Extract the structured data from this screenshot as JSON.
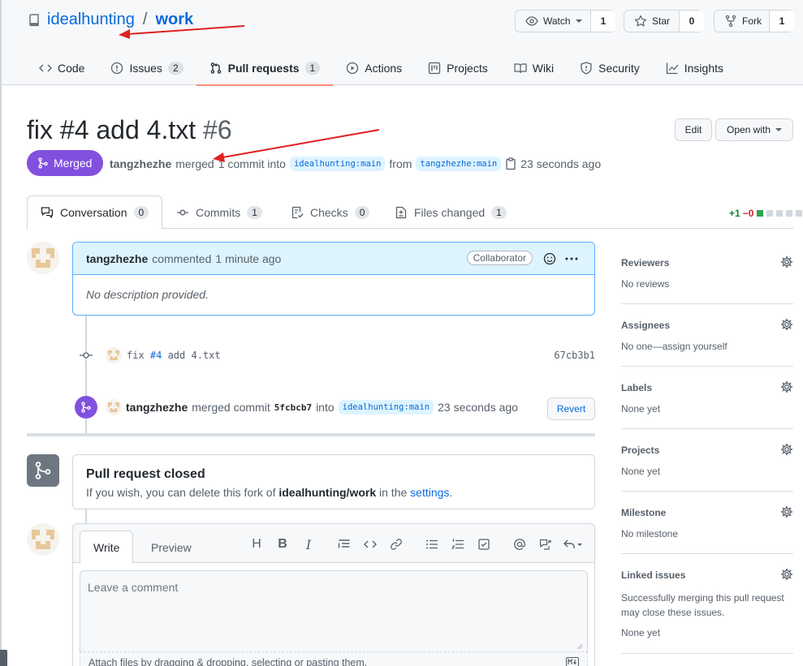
{
  "repo": {
    "owner": "idealhunting",
    "separator": "/",
    "name": "work"
  },
  "header_buttons": {
    "watch": {
      "label": "Watch",
      "count": "1"
    },
    "star": {
      "label": "Star",
      "count": "0"
    },
    "fork": {
      "label": "Fork",
      "count": "1"
    }
  },
  "nav": [
    {
      "label": "Code"
    },
    {
      "label": "Issues",
      "count": "2"
    },
    {
      "label": "Pull requests",
      "count": "1"
    },
    {
      "label": "Actions"
    },
    {
      "label": "Projects"
    },
    {
      "label": "Wiki"
    },
    {
      "label": "Security"
    },
    {
      "label": "Insights"
    }
  ],
  "pr": {
    "title": "fix #4 add 4.txt",
    "number": "#6",
    "state": "Merged",
    "author": "tangzhezhe",
    "action": "merged",
    "commit_text": "1 commit into",
    "base_branch": "idealhunting:main",
    "from": "from",
    "head_branch": "tangzhezhe:main",
    "time": "23 seconds ago",
    "edit_label": "Edit",
    "open_with_label": "Open with"
  },
  "tabs": [
    {
      "label": "Conversation",
      "count": "0"
    },
    {
      "label": "Commits",
      "count": "1"
    },
    {
      "label": "Checks",
      "count": "0"
    },
    {
      "label": "Files changed",
      "count": "1"
    }
  ],
  "diffstat": {
    "add": "+1",
    "del": "−0"
  },
  "comment": {
    "author": "tangzhezhe",
    "action": "commented",
    "time": "1 minute ago",
    "role": "Collaborator",
    "body": "No description provided."
  },
  "commit": {
    "message_prefix": "fix ",
    "message_link": "#4",
    "message_suffix": " add 4.txt",
    "sha": "67cb3b1"
  },
  "merge_event": {
    "author": "tangzhezhe",
    "text": "merged commit",
    "sha": "5fcbcb7",
    "into": "into",
    "branch": "idealhunting:main",
    "time": "23 seconds ago",
    "revert_label": "Revert"
  },
  "closed": {
    "title": "Pull request closed",
    "desc_prefix": "If you wish, you can delete this fork of ",
    "repo": "idealhunting/work",
    "desc_mid": " in the ",
    "settings_link": "settings",
    "desc_end": "."
  },
  "compose": {
    "write_tab": "Write",
    "preview_tab": "Preview",
    "placeholder": "Leave a comment",
    "attach_text": "Attach files by dragging & dropping, selecting or pasting them."
  },
  "sidebar": [
    {
      "heading": "Reviewers",
      "value": "No reviews"
    },
    {
      "heading": "Assignees",
      "value": "No one—assign yourself"
    },
    {
      "heading": "Labels",
      "value": "None yet"
    },
    {
      "heading": "Projects",
      "value": "None yet"
    },
    {
      "heading": "Milestone",
      "value": "No milestone"
    },
    {
      "heading": "Linked issues",
      "value": "Successfully merging this pull request may close these issues.",
      "value2": "None yet"
    }
  ],
  "colors": {
    "accent": "#0969da",
    "merged": "#8250df",
    "annotation": "#e02020"
  }
}
